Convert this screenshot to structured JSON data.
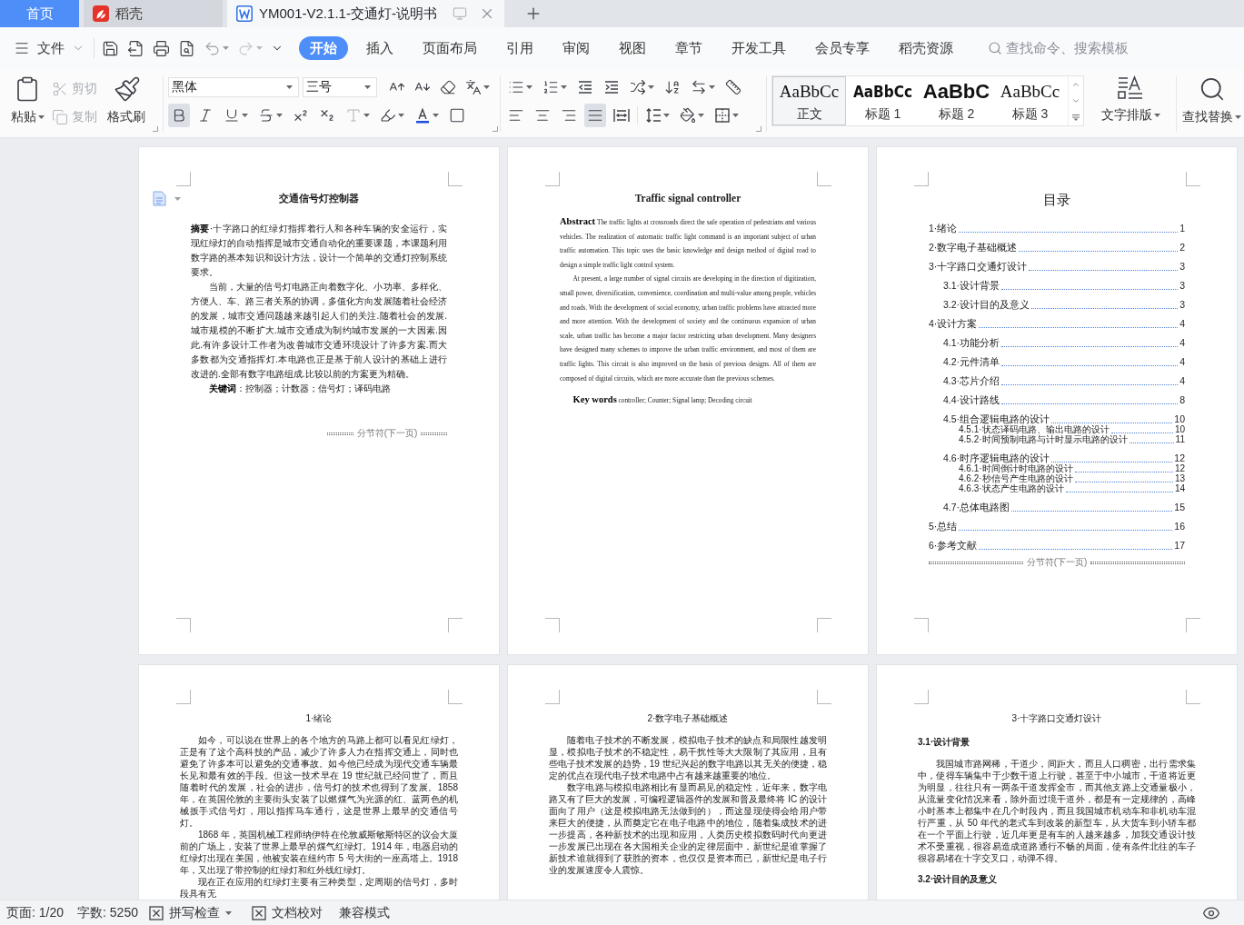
{
  "tabs": [
    {
      "kind": "home",
      "label": "首页",
      "selected": false
    },
    {
      "kind": "app",
      "label": "稻壳",
      "selected": false
    },
    {
      "kind": "document",
      "label": "YM001-V2.1.1-交通灯-说明书",
      "selected": true
    }
  ],
  "menu": {
    "file": "文件",
    "ribbon_tabs": [
      {
        "label": "开始",
        "selected": true
      },
      {
        "label": "插入",
        "selected": false
      },
      {
        "label": "页面布局",
        "selected": false
      },
      {
        "label": "引用",
        "selected": false
      },
      {
        "label": "审阅",
        "selected": false
      },
      {
        "label": "视图",
        "selected": false
      },
      {
        "label": "章节",
        "selected": false
      },
      {
        "label": "开发工具",
        "selected": false
      },
      {
        "label": "会员专享",
        "selected": false
      },
      {
        "label": "稻壳资源",
        "selected": false
      }
    ],
    "search": {
      "placeholder": "查找命令、搜索模板"
    }
  },
  "ribbon": {
    "clipboard": {
      "paste": "粘贴",
      "cut": {
        "label": "剪切",
        "disabled": true
      },
      "copy": {
        "label": "复制",
        "disabled": true
      },
      "format_painter": "格式刷"
    },
    "font": {
      "name": "黑体",
      "size": "三号",
      "bold": true
    },
    "paragraph": {
      "alignments": [
        {
          "kind": "left",
          "selected": false
        },
        {
          "kind": "center",
          "selected": false
        },
        {
          "kind": "right",
          "selected": false
        },
        {
          "kind": "justify",
          "selected": true
        },
        {
          "kind": "distributed",
          "selected": false
        }
      ]
    },
    "styles": [
      {
        "kind": "normal",
        "preview": "AaBbCc",
        "label": "正文",
        "selected": true
      },
      {
        "kind": "heading1",
        "preview": "AaBbCc",
        "label": "标题 1",
        "selected": false
      },
      {
        "kind": "heading2",
        "preview": "AaBbC",
        "label": "标题 2",
        "selected": false
      },
      {
        "kind": "heading3",
        "preview": "AaBbCc",
        "label": "标题 3",
        "selected": false
      }
    ],
    "text_layout": "文字排版",
    "find_replace": "查找替换"
  },
  "pages": [
    {
      "kind": "abstract",
      "blocks": [
        {
          "kind": "title",
          "text": "交通信号灯控制器"
        },
        {
          "kind": "abstract",
          "text": "**摘要**·十字路口的红绿灯指挥着行人和各种车辆的安全运行，实现红绿灯的自动指挥是城市交通自动化的重要课题，本课题利用数字路的基本知识和设计方法，设计一个简单的交通灯控制系统要求。"
        },
        {
          "kind": "paragraph",
          "text": "当前，大量的信号灯电路正向着数字化、小功率、多样化、方便人、车、路三者关系的协调，多值化方向发展随着社会经济的发展，城市交通问题越来越引起人们的关注.随着社会的发展.城市规模的不断扩大.城市交通成为制约城市发展的一大因素.因此.有许多设计工作者为改善城市交通环境设计了许多方案.而大多数都为交通指挥灯.本电路也正是基于前人设计的基础上进行改进的.全部有数字电路组成.比较以前的方案更为精确。"
        },
        {
          "kind": "keywords",
          "text": "**关键词**：控制器；计数器；信号灯；译码电路"
        },
        {
          "kind": "section_break",
          "text": "分节符(下一页)"
        }
      ]
    },
    {
      "kind": "translation",
      "blocks": [
        {
          "kind": "title",
          "text": "Traffic signal controller"
        },
        {
          "kind": "abstract",
          "text": "**Abstract** The traffic lights at crossroads direct the safe operation of pedestrians and various vehicles. The realization of automatic traffic light command is an important subject of urban traffic automation. This topic uses the basic knowledge and design method of digital road to design a simple traffic light control system."
        },
        {
          "kind": "paragraph",
          "text": "At present, a large number of signal circuits are developing in the direction of digitization, small power, diversification, convenience, coordination and multi-value among people, vehicles and roads. With the development of social economy, urban traffic problems have attracted more and more attention. With the development of society and the continuous expansion of urban scale, urban traffic has become a major factor restricting urban development. Many designers have designed many schemes to improve the urban traffic environment, and most of them are traffic lights. This circuit is also improved on the basis of previous designs. All of them are composed of digital circuits, which are more accurate than the previous schemes."
        },
        {
          "kind": "keywords",
          "text": "**Key words** controller; Counter; Signal lamp; Decoding circuit"
        }
      ]
    },
    {
      "kind": "contents",
      "blocks": [
        {
          "kind": "toc_title",
          "text": "目录"
        },
        {
          "kind": "toc",
          "entries": [
            {
              "label": "1·绪论",
              "page": "1"
            },
            {
              "label": "2·数字电子基础概述",
              "page": "2"
            },
            {
              "label": "3·十字路口交通灯设计",
              "page": "3",
              "children": [
                {
                  "label": "3.1·设计背景",
                  "page": "3"
                },
                {
                  "label": "3.2·设计目的及意义",
                  "page": "3"
                }
              ]
            },
            {
              "label": "4·设计方案",
              "page": "4",
              "children": [
                {
                  "label": "4.1·功能分析",
                  "page": "4"
                },
                {
                  "label": "4.2·元件清单",
                  "page": "4"
                },
                {
                  "label": "4.3·芯片介绍",
                  "page": "4"
                },
                {
                  "label": "4.4·设计路线",
                  "page": "8"
                },
                {
                  "label": "4.5·组合逻辑电路的设计",
                  "page": "10",
                  "children": [
                    {
                      "label": "4.5.1·状态译码电路、输出电路的设计",
                      "page": "10"
                    },
                    {
                      "label": "4.5.2·时间预制电路与计时显示电路的设计",
                      "page": "11"
                    }
                  ]
                },
                {
                  "label": "4.6·时序逻辑电路的设计",
                  "page": "12",
                  "children": [
                    {
                      "label": "4.6.1·时间倒计时电路的设计",
                      "page": "12"
                    },
                    {
                      "label": "4.6.2·秒信号产生电路的设计",
                      "page": "13"
                    },
                    {
                      "label": "4.6.3·状态产生电路的设计",
                      "page": "14"
                    }
                  ]
                },
                {
                  "label": "4.7·总体电路图",
                  "page": "15"
                }
              ]
            },
            {
              "label": "5·总结",
              "page": "16"
            },
            {
              "label": "6·参考文献",
              "page": "17"
            }
          ]
        },
        {
          "kind": "section_break",
          "text": "分节符(下一页)"
        }
      ]
    },
    {
      "kind": "chapter",
      "blocks": [
        {
          "kind": "heading",
          "text": "1·绪论"
        },
        {
          "kind": "paragraph",
          "text": "如今，可以说在世界上的各个地方的马路上都可以看见红绿灯，正是有了这个高科技的产品，减少了许多人力在指挥交通上，同时也避免了许多本可以避免的交通事故。如今他已经成为现代交通车辆最长见和最有效的手段。但这一技术早在 19 世纪就已经问世了，而且随着时代的发展，社会的进步，信号灯的技术也得到了发展。1858 年，在英国伦敦的主要街头安装了以燃煤气为光源的红、蓝两色的机械扳手式信号灯，用以指挥马车通行，这是世界上最早的交通信号灯。"
        },
        {
          "kind": "paragraph",
          "text": "1868 年，英国机械工程师纳伊特在伦敦威斯敏斯特区的议会大厦前的广场上，安装了世界上最早的煤气红绿灯。1914 年，电器启动的红绿灯出现在美国，他被安装在纽约市 5 号大街的一座高塔上。1918 年，又出现了带控制的红绿灯和红外线红绿灯。"
        },
        {
          "kind": "paragraph",
          "text": "现在正在应用的红绿灯主要有三种类型，定周期的信号灯，多时段具有无"
        }
      ]
    },
    {
      "kind": "chapter",
      "blocks": [
        {
          "kind": "heading",
          "text": "2·数字电子基础概述"
        },
        {
          "kind": "paragraph",
          "text": "随着电子技术的不断发展，模拟电子技术的缺点和局限性越发明显，模拟电子技术的不稳定性，易干扰性等大大限制了其应用，且有些电子技术发展的趋势，19 世纪兴起的数字电路以其无关的便捷，稳定的优点在现代电子技术电路中占有越来越重要的地位。"
        },
        {
          "kind": "paragraph",
          "text": "数字电路与模拟电路相比有显而易见的稳定性，近年来，数字电路又有了巨大的发展，可编程逻辑器件的发展和普及最终将 IC 的设计面向了用户（这是模拟电路无法做到的），而这显现使得会给用户带来巨大的便捷，从而奠定它在电子电路中的地位，随着集成技术的进一步提高，各种新技术的出现和应用，人类历史模拟数码时代向更进一步发展已出现在各大国相关企业的定律层面中，新世纪是谁掌握了新技术谁就得到了获胜的资本，也仅仅是资本而已，新世纪是电子行业的发展速度令人震惊。"
        }
      ]
    },
    {
      "kind": "chapter",
      "blocks": [
        {
          "kind": "heading",
          "text": "3·十字路口交通灯设计"
        },
        {
          "kind": "subheading",
          "text": "3.1·设计背景"
        },
        {
          "kind": "paragraph",
          "text": "我国城市路网稀，干道少，间距大，而且人口稠密，出行需求集中，使得车辆集中于少数干道上行驶，甚至于中小城市，干道将近更为明显，往往只有一两条干道发挥全市，而其他支路上交通量极小，从流量变化情况来看，除外面过境干道外，都是有一定规律的，高峰小时基本上都集中在几个时段内，而且我国城市机动车和非机动车混行严重，从 50 年代的老式车到改装的新型车，从大货车到小轿车都在一个平面上行驶，近几年更是有车的人越来越多，加我交通设计技术不受重视，很容易造成道路通行不畅的局面，使有条件北往的车子很容易堵在十字交叉口，动弹不得。"
        },
        {
          "kind": "subheading",
          "text": "3.2·设计目的及意义"
        }
      ]
    }
  ],
  "status_bar": {
    "page": "页面: 1/20",
    "words": "字数: 5250",
    "spell_check": "拼写检查",
    "proofread": "文档校对",
    "compat_mode": "兼容模式"
  }
}
